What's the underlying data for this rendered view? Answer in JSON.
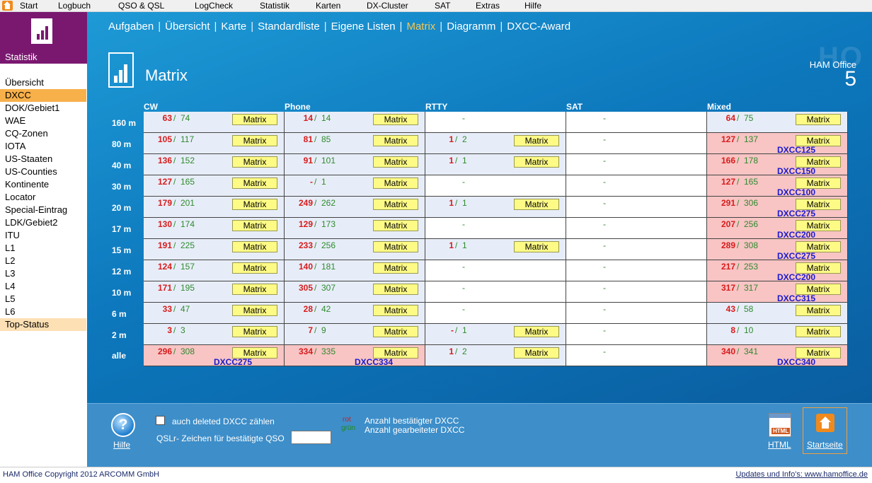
{
  "menu": [
    "Start",
    "Logbuch",
    "QSO & QSL",
    "LogCheck",
    "Statistik",
    "Karten",
    "DX-Cluster",
    "SAT",
    "Extras",
    "Hilfe"
  ],
  "sidebar": {
    "title": "Statistik",
    "items": [
      "Übersicht",
      "DXCC",
      "DOK/Gebiet1",
      "WAE",
      "CQ-Zonen",
      "IOTA",
      "US-Staaten",
      "US-Counties",
      "Kontinente",
      "Locator",
      "Special-Eintrag",
      "LDK/Gebiet2",
      "ITU",
      "L1",
      "L2",
      "L3",
      "L4",
      "L5",
      "L6",
      "Top-Status"
    ],
    "active": "DXCC"
  },
  "nav": [
    "Aufgaben",
    "Übersicht",
    "Karte",
    "Standardliste",
    "Eigene Listen",
    "Matrix",
    "Diagramm",
    "DXCC-Award"
  ],
  "nav_active": "Matrix",
  "page_title": "Matrix",
  "brand": {
    "watermark": "HO",
    "name": "HAM Office",
    "version": "5"
  },
  "columns": [
    "CW",
    "Phone",
    "RTTY",
    "SAT",
    "Mixed"
  ],
  "button_label": "Matrix",
  "rows": [
    {
      "band": "160 m",
      "cells": [
        {
          "c": "63",
          "w": "74",
          "bg": "blue"
        },
        {
          "c": "14",
          "w": "14",
          "bg": "blue"
        },
        {
          "bg": "white"
        },
        {
          "bg": "white"
        },
        {
          "c": "64",
          "w": "75",
          "bg": "blue"
        }
      ]
    },
    {
      "band": "80 m",
      "cells": [
        {
          "c": "105",
          "w": "117",
          "bg": "blue"
        },
        {
          "c": "81",
          "w": "85",
          "bg": "blue"
        },
        {
          "c": "1",
          "w": "2",
          "bg": "blue"
        },
        {
          "bg": "white"
        },
        {
          "c": "127",
          "w": "137",
          "bg": "pink",
          "award": "DXCC125"
        }
      ]
    },
    {
      "band": "40 m",
      "cells": [
        {
          "c": "136",
          "w": "152",
          "bg": "blue"
        },
        {
          "c": "91",
          "w": "101",
          "bg": "blue"
        },
        {
          "c": "1",
          "w": "1",
          "bg": "blue"
        },
        {
          "bg": "white"
        },
        {
          "c": "166",
          "w": "178",
          "bg": "pink",
          "award": "DXCC150"
        }
      ]
    },
    {
      "band": "30 m",
      "cells": [
        {
          "c": "127",
          "w": "165",
          "bg": "blue"
        },
        {
          "c": "-",
          "w": "1",
          "bg": "blue"
        },
        {
          "bg": "white"
        },
        {
          "bg": "white"
        },
        {
          "c": "127",
          "w": "165",
          "bg": "pink",
          "award": "DXCC100"
        }
      ]
    },
    {
      "band": "20 m",
      "cells": [
        {
          "c": "179",
          "w": "201",
          "bg": "blue"
        },
        {
          "c": "249",
          "w": "262",
          "bg": "blue"
        },
        {
          "c": "1",
          "w": "1",
          "bg": "blue"
        },
        {
          "bg": "white"
        },
        {
          "c": "291",
          "w": "306",
          "bg": "pink",
          "award": "DXCC275"
        }
      ]
    },
    {
      "band": "17 m",
      "cells": [
        {
          "c": "130",
          "w": "174",
          "bg": "blue"
        },
        {
          "c": "129",
          "w": "173",
          "bg": "blue"
        },
        {
          "bg": "white"
        },
        {
          "bg": "white"
        },
        {
          "c": "207",
          "w": "256",
          "bg": "pink",
          "award": "DXCC200"
        }
      ]
    },
    {
      "band": "15 m",
      "cells": [
        {
          "c": "191",
          "w": "225",
          "bg": "blue"
        },
        {
          "c": "233",
          "w": "256",
          "bg": "blue"
        },
        {
          "c": "1",
          "w": "1",
          "bg": "blue"
        },
        {
          "bg": "white"
        },
        {
          "c": "289",
          "w": "308",
          "bg": "pink",
          "award": "DXCC275"
        }
      ]
    },
    {
      "band": "12 m",
      "cells": [
        {
          "c": "124",
          "w": "157",
          "bg": "blue"
        },
        {
          "c": "140",
          "w": "181",
          "bg": "blue"
        },
        {
          "bg": "white"
        },
        {
          "bg": "white"
        },
        {
          "c": "217",
          "w": "253",
          "bg": "pink",
          "award": "DXCC200"
        }
      ]
    },
    {
      "band": "10 m",
      "cells": [
        {
          "c": "171",
          "w": "195",
          "bg": "blue"
        },
        {
          "c": "305",
          "w": "307",
          "bg": "blue"
        },
        {
          "bg": "white"
        },
        {
          "bg": "white"
        },
        {
          "c": "317",
          "w": "317",
          "bg": "pink",
          "award": "DXCC315"
        }
      ]
    },
    {
      "band": "6 m",
      "cells": [
        {
          "c": "33",
          "w": "47",
          "bg": "blue"
        },
        {
          "c": "28",
          "w": "42",
          "bg": "blue"
        },
        {
          "bg": "white"
        },
        {
          "bg": "white"
        },
        {
          "c": "43",
          "w": "58",
          "bg": "blue"
        }
      ]
    },
    {
      "band": "2 m",
      "cells": [
        {
          "c": "3",
          "w": "3",
          "bg": "blue"
        },
        {
          "c": "7",
          "w": "9",
          "bg": "blue"
        },
        {
          "c": "-",
          "w": "1",
          "bg": "blue"
        },
        {
          "bg": "white"
        },
        {
          "c": "8",
          "w": "10",
          "bg": "blue"
        }
      ]
    },
    {
      "band": "alle",
      "cells": [
        {
          "c": "296",
          "w": "308",
          "bg": "pink",
          "award": "DXCC275"
        },
        {
          "c": "334",
          "w": "335",
          "bg": "pink",
          "award": "DXCC334"
        },
        {
          "c": "1",
          "w": "2",
          "bg": "blue"
        },
        {
          "bg": "white"
        },
        {
          "c": "340",
          "w": "341",
          "bg": "pink",
          "award": "DXCC340"
        }
      ]
    }
  ],
  "bottom": {
    "help_label": "Hilfe",
    "checkbox_label": "auch deleted DXCC zählen",
    "qsl_label": "QSLr- Zeichen für bestätigte QSO",
    "qsl_value": "",
    "legend_rot": "rot",
    "legend_gruen": "grün",
    "legend_confirmed": "Anzahl bestätigter DXCC",
    "legend_worked": "Anzahl gearbeiteter DXCC",
    "html_label": "HTML",
    "html_tag": "HTML",
    "start_label": "Startseite"
  },
  "footer": {
    "copyright": "HAM Office Copyright 2012 ARCOMM GmbH",
    "updates": "Updates und Info's: www.hamoffice.de"
  },
  "colors": {
    "confirmed": "#d81b1b",
    "worked": "#2e8a2e",
    "award": "#1a1acc",
    "accent": "#f6c650",
    "sidebar_header": "#7a1870"
  }
}
